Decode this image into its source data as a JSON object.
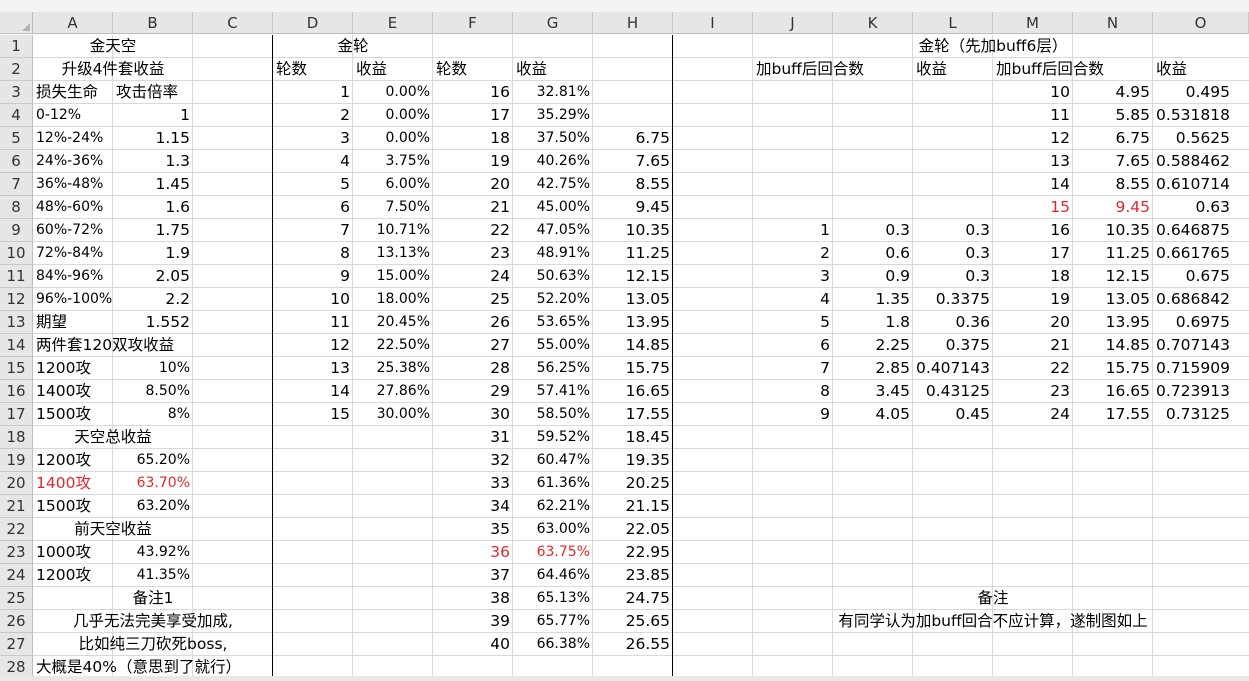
{
  "columns": [
    "A",
    "B",
    "C",
    "D",
    "E",
    "F",
    "G",
    "H",
    "I",
    "J",
    "K",
    "L",
    "M",
    "N",
    "O"
  ],
  "rows": [
    "1",
    "2",
    "3",
    "4",
    "5",
    "6",
    "7",
    "8",
    "9",
    "10",
    "11",
    "12",
    "13",
    "14",
    "15",
    "16",
    "17",
    "18",
    "19",
    "20",
    "21",
    "22",
    "23",
    "24",
    "25",
    "26",
    "27",
    "28"
  ],
  "cells": {
    "A1": "金天空",
    "A2": "升级4件套收益",
    "A3": "损失生命",
    "B3": "攻击倍率",
    "A4": "0-12%",
    "B4": "1",
    "A5": "12%-24%",
    "B5": "1.15",
    "A6": "24%-36%",
    "B6": "1.3",
    "A7": "36%-48%",
    "B7": "1.45",
    "A8": "48%-60%",
    "B8": "1.6",
    "A9": "60%-72%",
    "B9": "1.75",
    "A10": "72%-84%",
    "B10": "1.9",
    "A11": "84%-96%",
    "B11": "2.05",
    "A12": "96%-100%",
    "B12": "2.2",
    "A13": "期望",
    "B13": "1.552",
    "A14": "两件套120双攻收益",
    "A15": "1200攻",
    "B15": "10%",
    "A16": "1400攻",
    "B16": "8.50%",
    "A17": "1500攻",
    "B17": "8%",
    "A18": "天空总收益",
    "A19": "1200攻",
    "B19": "65.20%",
    "A20": "1400攻",
    "B20": "63.70%",
    "A21": "1500攻",
    "B21": "63.20%",
    "A22": "前天空收益",
    "A23": "1000攻",
    "B23": "43.92%",
    "A24": "1200攻",
    "B24": "41.35%",
    "A25": "备注1",
    "A26": "几乎无法完美享受加成,",
    "A27": "比如纯三刀砍死boss,",
    "A28": "大概是40%（意思到了就行）",
    "D1": "金轮",
    "D2": "轮数",
    "E2": "收益",
    "F2": "轮数",
    "G2": "收益",
    "J1": "金轮（先加buff6层）",
    "J2": "加buff后回合数",
    "L2": "收益",
    "M2": "加buff后回合数",
    "O2": "收益",
    "J25": "备注",
    "J26": "有同学认为加buff回合不应计算，遂制图如上"
  },
  "colD": [
    "1",
    "2",
    "3",
    "4",
    "5",
    "6",
    "7",
    "8",
    "9",
    "10",
    "11",
    "12",
    "13",
    "14",
    "15"
  ],
  "colE": [
    "0.00%",
    "0.00%",
    "0.00%",
    "3.75%",
    "6.00%",
    "7.50%",
    "10.71%",
    "13.13%",
    "15.00%",
    "18.00%",
    "20.45%",
    "22.50%",
    "25.38%",
    "27.86%",
    "30.00%"
  ],
  "colF": [
    "16",
    "17",
    "18",
    "19",
    "20",
    "21",
    "22",
    "23",
    "24",
    "25",
    "26",
    "27",
    "28",
    "29",
    "30",
    "31",
    "32",
    "33",
    "34",
    "35",
    "36",
    "37",
    "38",
    "39",
    "40"
  ],
  "colG": [
    "32.81%",
    "35.29%",
    "37.50%",
    "40.26%",
    "42.75%",
    "45.00%",
    "47.05%",
    "48.91%",
    "50.63%",
    "52.20%",
    "53.65%",
    "55.00%",
    "56.25%",
    "57.41%",
    "58.50%",
    "59.52%",
    "60.47%",
    "61.36%",
    "62.21%",
    "63.00%",
    "63.75%",
    "64.46%",
    "65.13%",
    "65.77%",
    "66.38%"
  ],
  "colH": [
    "",
    "",
    "6.75",
    "7.65",
    "8.55",
    "9.45",
    "10.35",
    "11.25",
    "12.15",
    "13.05",
    "13.95",
    "14.85",
    "15.75",
    "16.65",
    "17.55",
    "18.45",
    "19.35",
    "20.25",
    "21.15",
    "22.05",
    "22.95",
    "23.85",
    "24.75",
    "25.65",
    "26.55"
  ],
  "colJ": [
    "1",
    "2",
    "3",
    "4",
    "5",
    "6",
    "7",
    "8",
    "9"
  ],
  "colK": [
    "0.3",
    "0.6",
    "0.9",
    "1.35",
    "1.8",
    "2.25",
    "2.85",
    "3.45",
    "4.05"
  ],
  "colL": [
    "0.3",
    "0.3",
    "0.3",
    "0.3375",
    "0.36",
    "0.375",
    "0.407143",
    "0.43125",
    "0.45"
  ],
  "colM": [
    "10",
    "11",
    "12",
    "13",
    "14",
    "15",
    "16",
    "17",
    "18",
    "19",
    "20",
    "21",
    "22",
    "23",
    "24"
  ],
  "colN": [
    "4.95",
    "5.85",
    "6.75",
    "7.65",
    "8.55",
    "9.45",
    "10.35",
    "11.25",
    "12.15",
    "13.05",
    "13.95",
    "14.85",
    "15.75",
    "16.65",
    "17.55"
  ],
  "colO": [
    "0.495",
    "0.531818",
    "0.5625",
    "0.588462",
    "0.610714",
    "0.63",
    "0.646875",
    "0.661765",
    "0.675",
    "0.686842",
    "0.6975",
    "0.707143",
    "0.715909",
    "0.723913",
    "0.73125"
  ],
  "colors": {
    "highlight": "#e0282c",
    "header_bg": "#e6e6e6",
    "grid": "#d9d9d9"
  }
}
